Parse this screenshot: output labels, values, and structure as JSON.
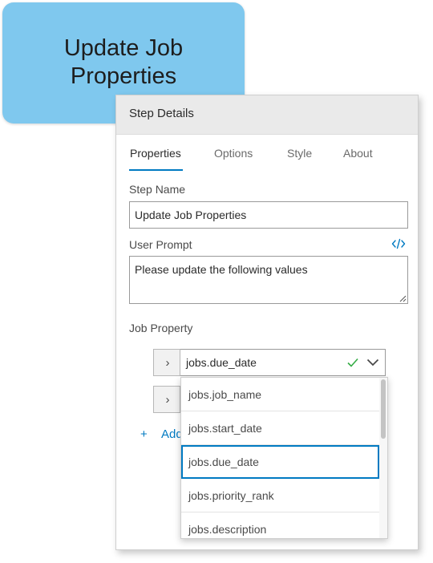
{
  "step": {
    "title_line1": "Update Job",
    "title_line2": "Properties"
  },
  "panel": {
    "title": "Step Details",
    "tabs": [
      {
        "label": "Properties",
        "active": true
      },
      {
        "label": "Options"
      },
      {
        "label": "Style"
      },
      {
        "label": "About"
      }
    ],
    "step_name": {
      "label": "Step Name",
      "value": "Update Job Properties"
    },
    "user_prompt": {
      "label": "User Prompt",
      "value": "Please update the following values"
    },
    "job_property": {
      "label": "Job Property",
      "selected_value": "jobs.due_date",
      "add_label": "Add"
    }
  },
  "dropdown": {
    "options": [
      "jobs.job_name",
      "jobs.start_date",
      "jobs.due_date",
      "jobs.priority_rank",
      "jobs.description"
    ],
    "selected": "jobs.due_date"
  },
  "colors": {
    "node": "#7fc8ee",
    "accent": "#007ac2",
    "check": "#35ac46"
  },
  "icons": [
    "chevron-right-icon",
    "code-icon",
    "check-icon",
    "chevron-down-icon",
    "plus-icon",
    "resize-grip-icon"
  ]
}
